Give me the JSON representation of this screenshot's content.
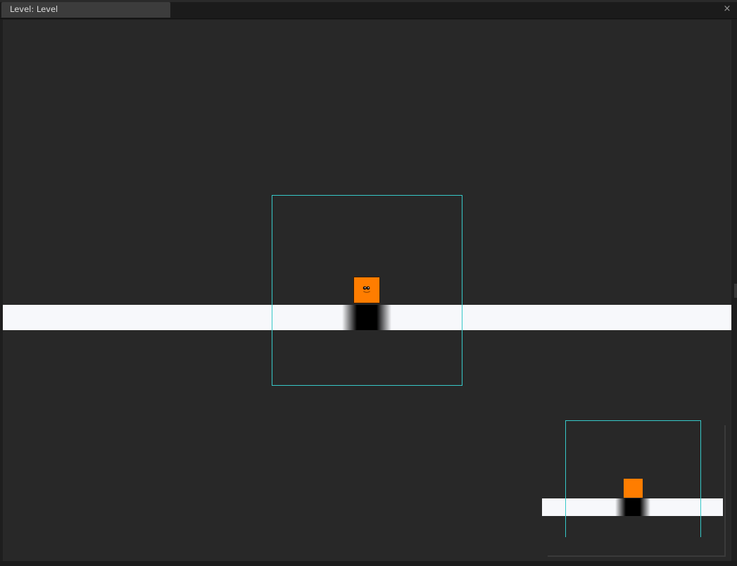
{
  "window": {
    "tab_title": "Level: Level",
    "close_symbol": "×"
  },
  "icons": {
    "close": "close-icon",
    "player_face": "player-face-icon"
  },
  "colors": {
    "background": "#282828",
    "floor": "#f7f8fb",
    "camera_frame": "#37c8c8",
    "player": "#ff7d00"
  }
}
